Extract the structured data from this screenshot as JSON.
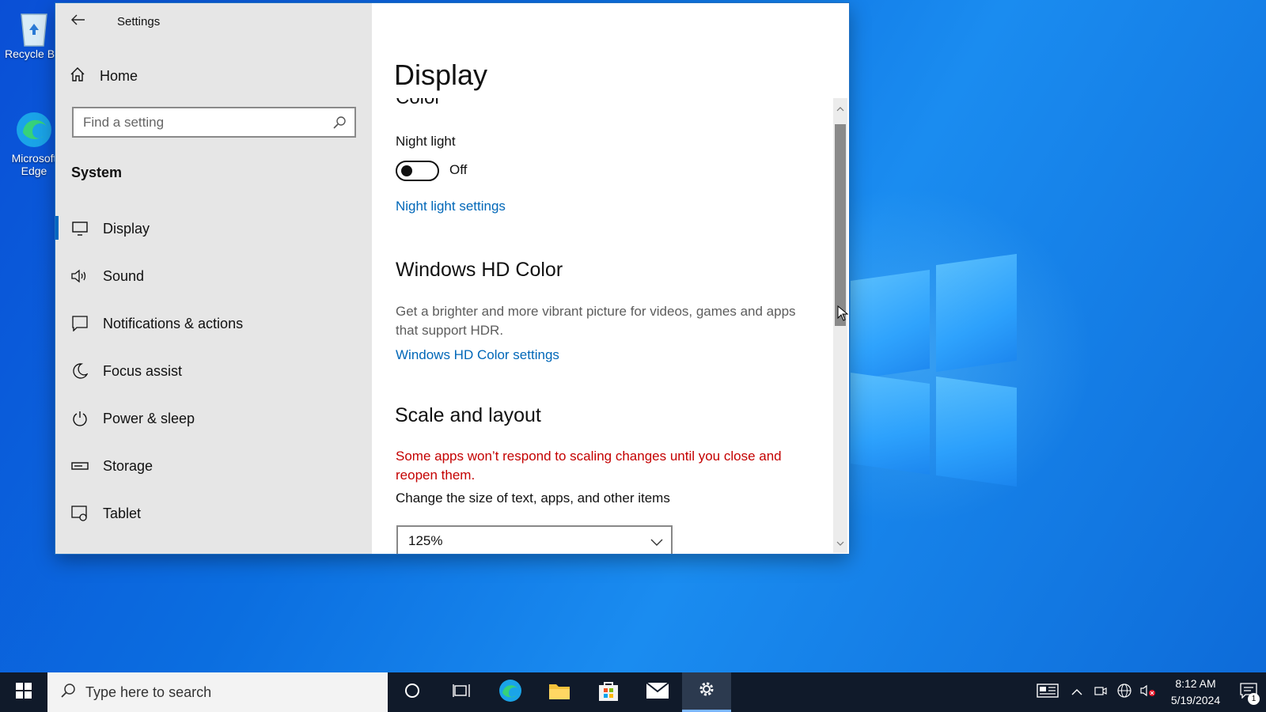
{
  "desktop": {
    "icons": [
      {
        "label": "Recycle Bin",
        "icon": "recycle-bin-icon"
      },
      {
        "label": "Microsoft Edge",
        "icon": "edge-icon"
      }
    ]
  },
  "window": {
    "title": "Settings",
    "home_label": "Home",
    "search_placeholder": "Find a setting",
    "section": "System",
    "nav": [
      {
        "label": "Display",
        "icon": "monitor-icon",
        "active": true
      },
      {
        "label": "Sound",
        "icon": "speaker-icon"
      },
      {
        "label": "Notifications & actions",
        "icon": "notification-icon"
      },
      {
        "label": "Focus assist",
        "icon": "moon-icon"
      },
      {
        "label": "Power & sleep",
        "icon": "power-icon"
      },
      {
        "label": "Storage",
        "icon": "storage-icon"
      },
      {
        "label": "Tablet",
        "icon": "tablet-icon"
      }
    ]
  },
  "content": {
    "page_title": "Display",
    "color_heading": "Color",
    "night_light_label": "Night light",
    "night_light_state": "Off",
    "night_light_link": "Night light settings",
    "hd_heading": "Windows HD Color",
    "hd_desc": "Get a brighter and more vibrant picture for videos, games and apps that support HDR.",
    "hd_link": "Windows HD Color settings",
    "scale_heading": "Scale and layout",
    "scale_warning": "Some apps won’t respond to scaling changes until you close and reopen them.",
    "scale_label": "Change the size of text, apps, and other items",
    "scale_value": "125%"
  },
  "taskbar": {
    "search_placeholder": "Type here to search",
    "time": "8:12 AM",
    "date": "5/19/2024",
    "notification_count": "1"
  },
  "colors": {
    "accent": "#0067b8",
    "warning": "#c40000",
    "taskbar": "#101a2a"
  }
}
